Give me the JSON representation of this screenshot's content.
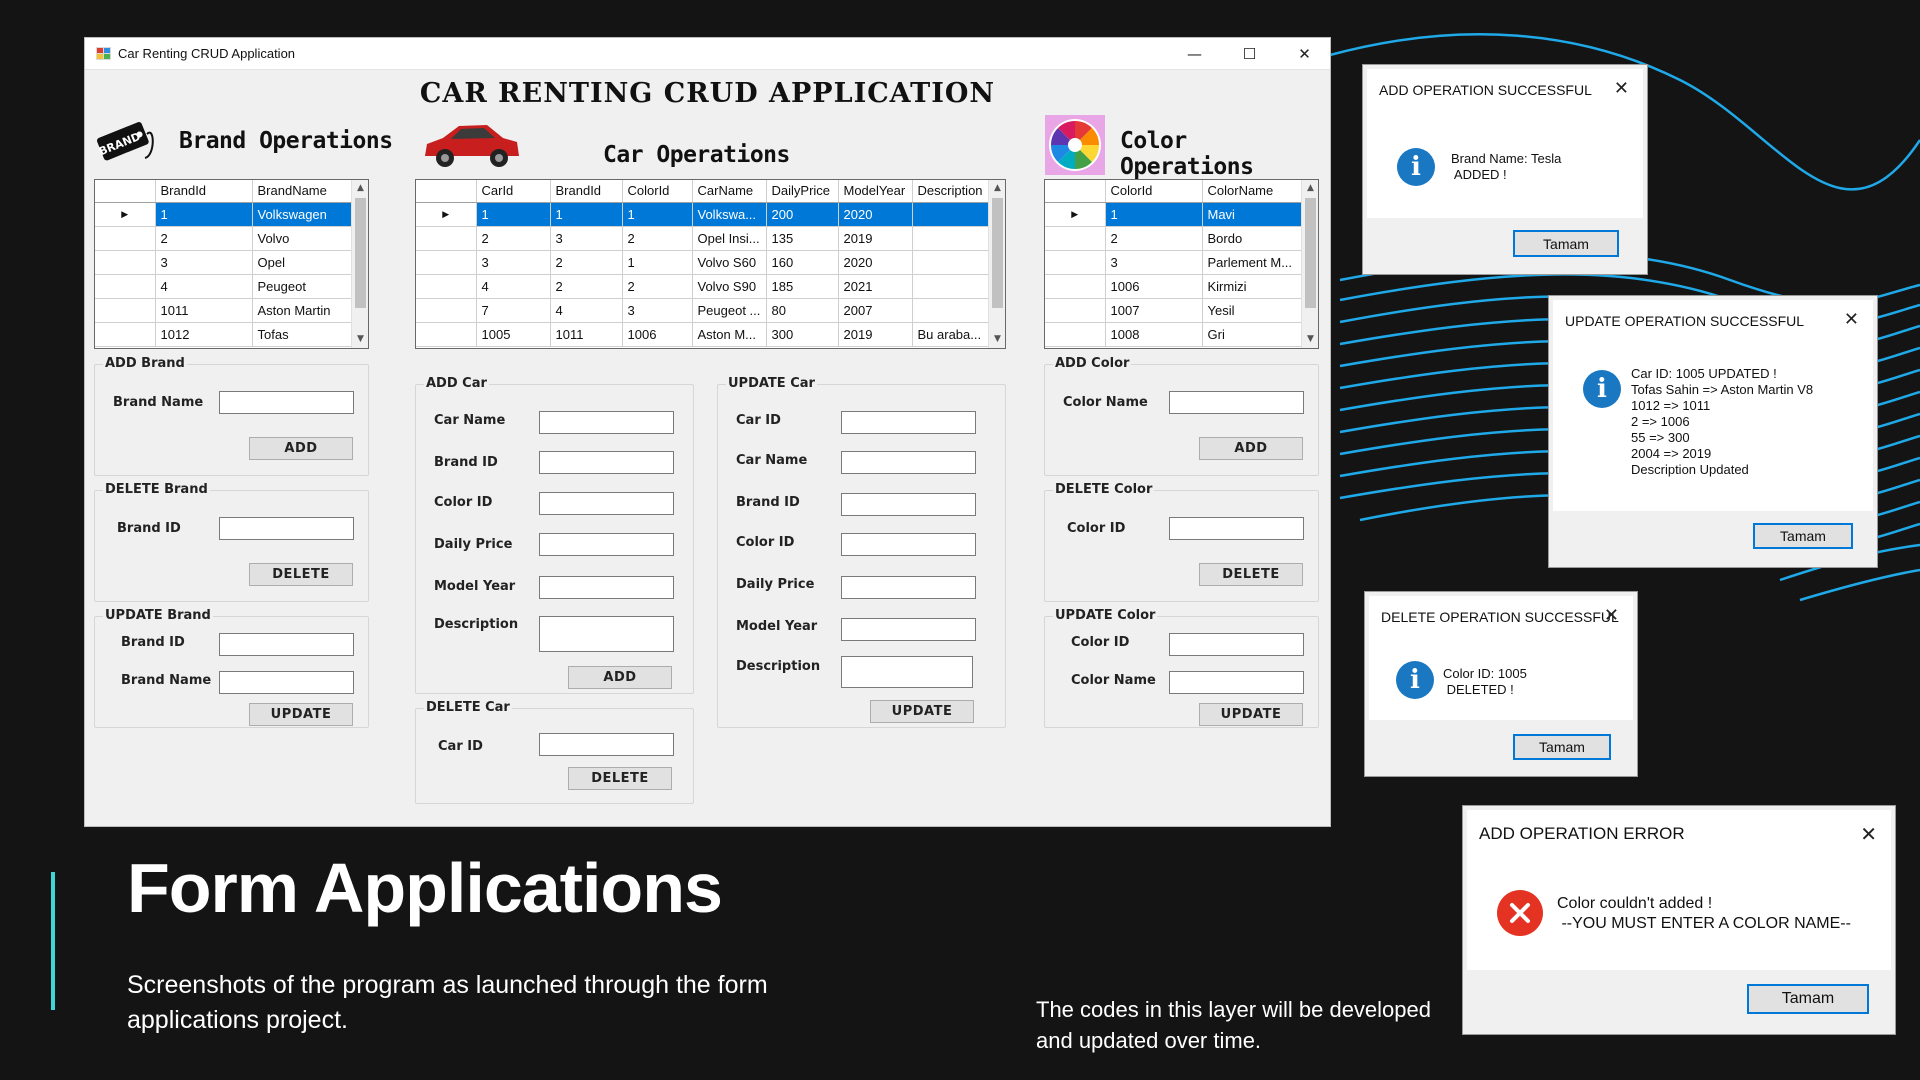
{
  "window": {
    "title": "Car Renting CRUD Application",
    "minimize": "—",
    "maximize": "☐",
    "close": "✕"
  },
  "heading": "CAR RENTING CRUD APPLICATION",
  "brand": {
    "section_title": "Brand Operations",
    "icon_text": "BRAND",
    "columns": [
      "BrandId",
      "BrandName"
    ],
    "rows": [
      [
        "1",
        "Volkswagen"
      ],
      [
        "2",
        "Volvo"
      ],
      [
        "3",
        "Opel"
      ],
      [
        "4",
        "Peugeot"
      ],
      [
        "1011",
        "Aston Martin"
      ],
      [
        "1012",
        "Tofas"
      ]
    ],
    "add": {
      "group": "ADD Brand",
      "label": "Brand Name",
      "button": "ADD"
    },
    "delete": {
      "group": "DELETE Brand",
      "label": "Brand ID",
      "button": "DELETE"
    },
    "update": {
      "group": "UPDATE Brand",
      "label_id": "Brand ID",
      "label_name": "Brand Name",
      "button": "UPDATE"
    }
  },
  "car": {
    "section_title": "Car Operations",
    "columns": [
      "CarId",
      "BrandId",
      "ColorId",
      "CarName",
      "DailyPrice",
      "ModelYear",
      "Description"
    ],
    "rows": [
      [
        "1",
        "1",
        "1",
        "Volkswa...",
        "200",
        "2020",
        ""
      ],
      [
        "2",
        "3",
        "2",
        "Opel Insi...",
        "135",
        "2019",
        ""
      ],
      [
        "3",
        "2",
        "1",
        "Volvo S60",
        "160",
        "2020",
        ""
      ],
      [
        "4",
        "2",
        "2",
        "Volvo S90",
        "185",
        "2021",
        ""
      ],
      [
        "7",
        "4",
        "3",
        "Peugeot ...",
        "80",
        "2007",
        ""
      ],
      [
        "1005",
        "1011",
        "1006",
        "Aston M...",
        "300",
        "2019",
        "Bu araba..."
      ]
    ],
    "add": {
      "group": "ADD Car",
      "labels": [
        "Car Name",
        "Brand ID",
        "Color ID",
        "Daily Price",
        "Model Year",
        "Description"
      ],
      "button": "ADD"
    },
    "delete": {
      "group": "DELETE Car",
      "label": "Car ID",
      "button": "DELETE"
    },
    "update": {
      "group": "UPDATE Car",
      "labels": [
        "Car ID",
        "Car Name",
        "Brand ID",
        "Color ID",
        "Daily Price",
        "Model Year",
        "Description"
      ],
      "button": "UPDATE"
    }
  },
  "color": {
    "section_title": "Color Operations",
    "columns": [
      "ColorId",
      "ColorName"
    ],
    "rows": [
      [
        "1",
        "Mavi"
      ],
      [
        "2",
        "Bordo"
      ],
      [
        "3",
        "Parlement M..."
      ],
      [
        "1006",
        "Kirmizi"
      ],
      [
        "1007",
        "Yesil"
      ],
      [
        "1008",
        "Gri"
      ]
    ],
    "add": {
      "group": "ADD Color",
      "label": "Color Name",
      "button": "ADD"
    },
    "delete": {
      "group": "DELETE Color",
      "label": "Color ID",
      "button": "DELETE"
    },
    "update": {
      "group": "UPDATE Color",
      "label_id": "Color ID",
      "label_name": "Color Name",
      "button": "UPDATE"
    }
  },
  "dialogs": {
    "add_success": {
      "title": "ADD OPERATION SUCCESSFUL",
      "message": "Brand Name: Tesla\n ADDED !",
      "button": "Tamam"
    },
    "update_success": {
      "title": "UPDATE OPERATION SUCCESSFUL",
      "message": "Car ID: 1005 UPDATED !\nTofas Sahin => Aston Martin V8\n1012 => 1011\n2 => 1006\n55 => 300\n2004 => 2019\nDescription Updated",
      "button": "Tamam"
    },
    "delete_success": {
      "title": "DELETE OPERATION SUCCESSFUL",
      "message": "Color ID: 1005\n DELETED !",
      "button": "Tamam"
    },
    "add_error": {
      "title": "ADD OPERATION ERROR",
      "message": "Color couldn't added !\n --YOU MUST ENTER A COLOR NAME--",
      "button": "Tamam"
    }
  },
  "slide": {
    "headline": "Form Applications",
    "subtext": "Screenshots of the program as launched through the form applications project.",
    "note": "The codes in this layer will be developed and updated over time.",
    "accent_color": "#3fd7d6"
  },
  "colors": {
    "selection": "#0078d7",
    "info": "#1a78c2",
    "error": "#e53323",
    "waves": "#1fa9e8"
  }
}
